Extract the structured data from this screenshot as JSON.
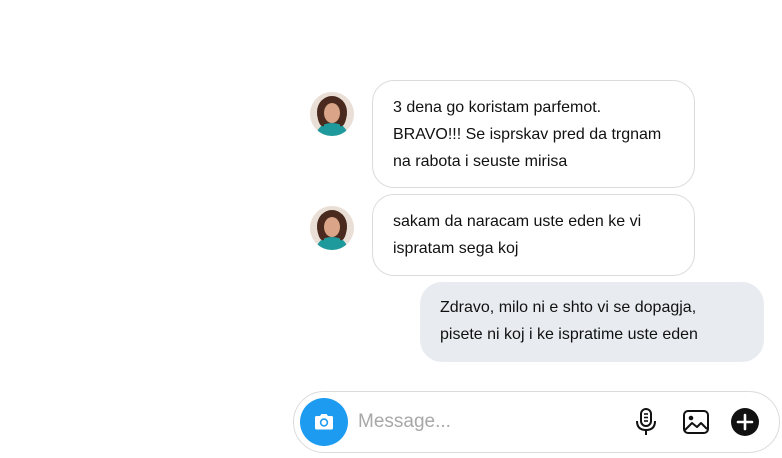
{
  "messages": [
    {
      "direction": "incoming",
      "lines": [
        "3 dena go koristam parfemot.",
        "BRAVO!!! Se isprskav pred da trgnam",
        "na rabota i seuste mirisa"
      ]
    },
    {
      "direction": "incoming",
      "lines": [
        "sakam da naracam uste eden ke vi",
        "ispratam sega koj"
      ]
    },
    {
      "direction": "outgoing",
      "lines": [
        "Zdravo, milo ni e shto vi se dopagja,",
        "pisete ni koj i ke ispratime uste eden"
      ]
    }
  ],
  "composer": {
    "placeholder": "Message...",
    "icons": {
      "camera": "camera-icon",
      "mic": "microphone-icon",
      "gallery": "image-icon",
      "more": "plus-circle-icon"
    }
  },
  "colors": {
    "accent": "#1d9bf0",
    "outgoing_bubble": "#e8ecf0",
    "incoming_border": "#dbdbdb",
    "placeholder": "#a8a8a8"
  }
}
